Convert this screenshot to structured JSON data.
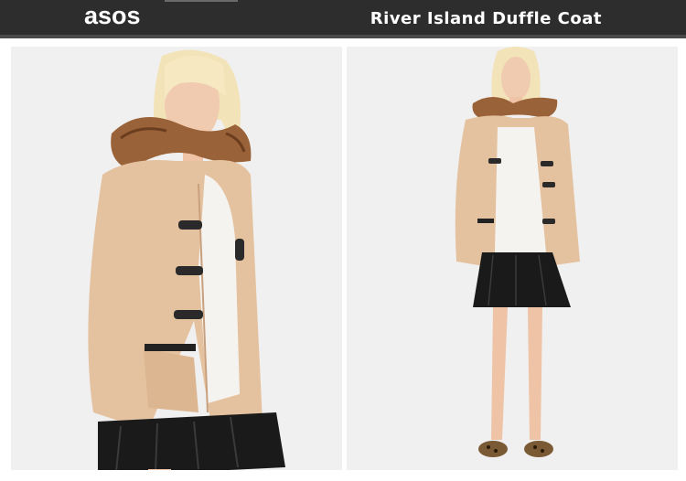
{
  "header": {
    "logo": "asos",
    "product_title": "River Island Duffle Coat"
  },
  "gallery": {
    "images": [
      {
        "subject": "close-up-front-view"
      },
      {
        "subject": "full-length-front-view"
      }
    ]
  },
  "colors": {
    "header_bg": "#2d2d2d",
    "coat": "#e5c29f",
    "fur": "#9a6238",
    "skirt": "#1a1a1a"
  }
}
